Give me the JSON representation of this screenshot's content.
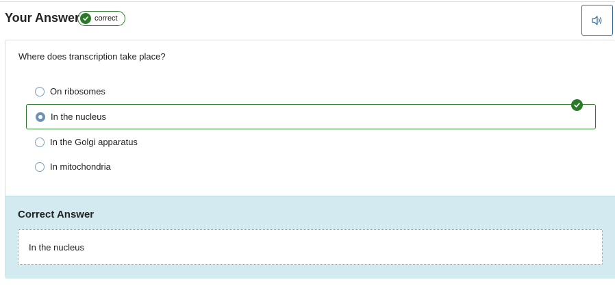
{
  "header": {
    "title": "Your Answer",
    "badge": "correct"
  },
  "audio_button": {
    "icon": "speaker-icon"
  },
  "question": {
    "prompt": "Where does transcription take place?",
    "options": [
      {
        "label": "On ribosomes",
        "selected": false
      },
      {
        "label": "In the nucleus",
        "selected": true
      },
      {
        "label": "In the Golgi apparatus",
        "selected": false
      },
      {
        "label": "In mitochondria",
        "selected": false
      }
    ]
  },
  "correct_answer": {
    "title": "Correct Answer",
    "value": "In the nucleus"
  },
  "colors": {
    "success": "#2a7a2a",
    "correct_bg": "#d3ebf0",
    "radio": "#7d9db8"
  }
}
